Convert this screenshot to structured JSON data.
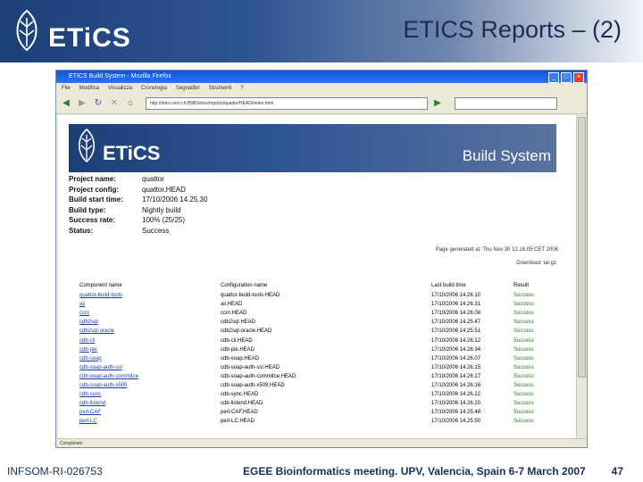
{
  "slide": {
    "title": "ETICS Reports – (2)",
    "footer_left": "INFSOM-RI-026753",
    "footer_center": "EGEE Bioinformatics meeting. UPV, Valencia, Spain 6-7 March 2007",
    "page_number": "47",
    "logo_text": "ETiCS"
  },
  "browser": {
    "window_title": "ETICS Build System - Mozilla Firefox",
    "menu": [
      "File",
      "Modifica",
      "Visualizza",
      "Cronologia",
      "Segnalibri",
      "Strumenti",
      "?"
    ],
    "url": "http://etics.cern.ch:8080/etics/reports/quattor/HEAD/index.html",
    "status": "Completato"
  },
  "page": {
    "banner_title": "Build System",
    "info": [
      {
        "label": "Project name:",
        "value": "quattor"
      },
      {
        "label": "Project config:",
        "value": "quattor.HEAD"
      },
      {
        "label": "Build start time:",
        "value": "17/10/2006 14.25.30"
      },
      {
        "label": "Build type:",
        "value": "Nightly build"
      },
      {
        "label": "Success rate:",
        "value": "100% (25/25)"
      },
      {
        "label": "Status:",
        "value": "Success"
      }
    ],
    "generated": "Page generated at: Thu Nov 30 12.16.05 CET 2006",
    "download": "Download: tar.gz",
    "columns": [
      "Component name",
      "Configuration name",
      "Last build time",
      "Result"
    ],
    "rows": [
      [
        "quattor-build-tools",
        "quattor-build-tools.HEAD",
        "17/10/2006 14.26.10",
        "Success"
      ],
      [
        "aii",
        "aii.HEAD",
        "17/10/2006 14.26.31",
        "Success"
      ],
      [
        "ccm",
        "ccm.HEAD",
        "17/10/2006 14.26.08",
        "Success"
      ],
      [
        "cdb2sql",
        "cdb2sql.HEAD",
        "17/10/2006 14.25.47",
        "Success"
      ],
      [
        "cdb2sql-oracle",
        "cdb2sql-oracle.HEAD",
        "17/10/2006 14.25.51",
        "Success"
      ],
      [
        "cdb-cli",
        "cdb-cli.HEAD",
        "17/10/2006 14.26.12",
        "Success"
      ],
      [
        "cdb-pie",
        "cdb-pie.HEAD",
        "17/10/2006 14.26.34",
        "Success"
      ],
      [
        "cdb-soap",
        "cdb-soap.HEAD",
        "17/10/2006 14.26.07",
        "Success"
      ],
      [
        "cdb-soap-auth-ssl",
        "cdb-soap-auth-ssl.HEAD",
        "17/10/2006 14.26.15",
        "Success"
      ],
      [
        "cdb-soap-auth-commitce",
        "cdb-soap-auth-commitce.HEAD",
        "17/10/2006 14.26.17",
        "Success"
      ],
      [
        "cdb-soap-auth-x509",
        "cdb-soap-auth-x509.HEAD",
        "17/10/2006 14.26.16",
        "Success"
      ],
      [
        "cdb-sync",
        "cdb-sync.HEAD",
        "17/10/2006 14.26.22",
        "Success"
      ],
      [
        "cdb-listend",
        "cdb-listend.HEAD",
        "17/10/2006 14.26.20",
        "Success"
      ],
      [
        "perl-CAF",
        "perl-CAF.HEAD",
        "17/10/2006 14.25.48",
        "Success"
      ],
      [
        "perl-LC",
        "perl-LC.HEAD",
        "17/10/2006 14.25.50",
        "Success"
      ]
    ]
  },
  "colors": {
    "header_dark": "#1c3f78",
    "link": "#1a3fb0",
    "success": "#1f7a1f"
  }
}
